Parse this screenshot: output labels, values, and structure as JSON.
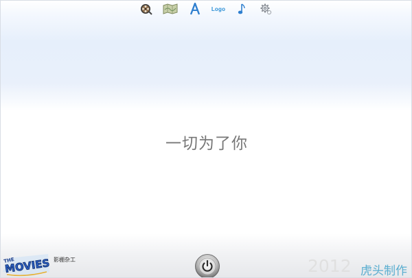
{
  "toolbar": {
    "items": [
      {
        "name": "film-reel-icon"
      },
      {
        "name": "map-image-icon"
      },
      {
        "name": "font-letter-icon"
      },
      {
        "label": "Logo"
      },
      {
        "name": "music-note-icon"
      },
      {
        "name": "settings-gear-icon"
      }
    ]
  },
  "main": {
    "slogan": "一切为了你"
  },
  "footer": {
    "brand_logo_text": "THE MOVIES",
    "brand_sub": "影棚杂工",
    "year": "2012",
    "credit": "虎头制作"
  },
  "colors": {
    "accent": "#2b8fd6",
    "credit": "#5aaed0",
    "slogan": "#777777"
  }
}
